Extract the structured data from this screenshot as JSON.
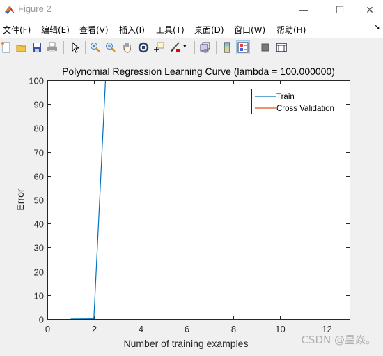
{
  "window": {
    "title": "Figure 2",
    "controls": {
      "minimize": "—",
      "maximize": "☐",
      "close": "✕"
    }
  },
  "menu": [
    {
      "label": "文件(F)"
    },
    {
      "label": "编辑(E)"
    },
    {
      "label": "查看(V)"
    },
    {
      "label": "插入(I)"
    },
    {
      "label": "工具(T)"
    },
    {
      "label": "桌面(D)"
    },
    {
      "label": "窗口(W)"
    },
    {
      "label": "帮助(H)"
    }
  ],
  "toolbar": {
    "icons": [
      "new-figure-icon",
      "open-file-icon",
      "save-icon",
      "print-icon",
      "edit-plot-arrow-icon",
      "zoom-in-icon",
      "zoom-out-icon",
      "pan-hand-icon",
      "rotate-3d-icon",
      "data-cursor-icon",
      "brush-icon",
      "link-plot-icon",
      "colorbar-icon",
      "legend-icon",
      "hide-plot-tools-icon",
      "show-plot-tools-icon"
    ]
  },
  "watermark": "CSDN @星焱。",
  "chart_data": {
    "type": "line",
    "title": "Polynomial Regression Learning Curve (lambda = 100.000000)",
    "xlabel": "Number of training examples",
    "ylabel": "Error",
    "xlim": [
      0,
      13
    ],
    "ylim": [
      0,
      100
    ],
    "xticks": [
      0,
      2,
      4,
      6,
      8,
      10,
      12
    ],
    "yticks": [
      0,
      10,
      20,
      30,
      40,
      50,
      60,
      70,
      80,
      90,
      100
    ],
    "grid": false,
    "legend_position": "top-right",
    "series": [
      {
        "name": "Train",
        "color": "#0072bd",
        "x": [
          1,
          2,
          2.5
        ],
        "y": [
          0,
          0.1,
          100
        ]
      },
      {
        "name": "Cross Validation",
        "color": "#d95319",
        "x": [],
        "y": []
      }
    ]
  }
}
